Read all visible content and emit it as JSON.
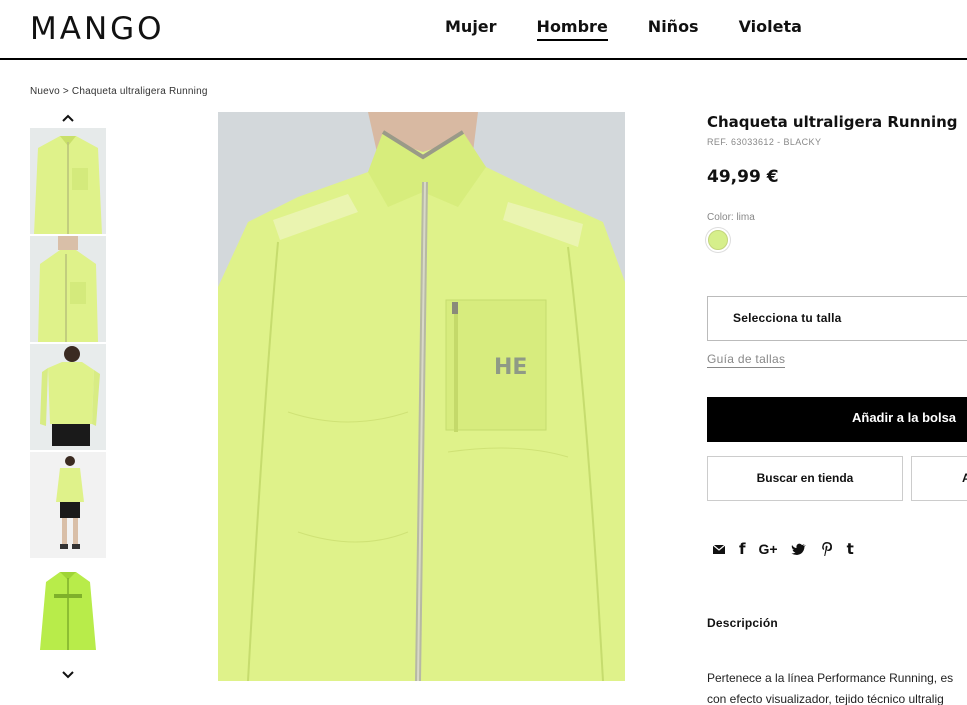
{
  "header": {
    "logo": "MANGO",
    "nav": [
      {
        "label": "Mujer",
        "active": false
      },
      {
        "label": "Hombre",
        "active": true
      },
      {
        "label": "Niños",
        "active": false
      },
      {
        "label": "Violeta",
        "active": false
      }
    ]
  },
  "breadcrumb": "Nuevo > Chaqueta ultraligera Running",
  "product": {
    "title": "Chaqueta ultraligera Running",
    "ref": "REF. 63033612 - BLACKY",
    "price": "49,99 €",
    "color_label": "Color: lima",
    "color_swatch": "#d6ef8b",
    "size_select": "Selecciona tu talla",
    "size_guide": "Guía de tallas",
    "add_to_bag": "Añadir a la bolsa",
    "find_in_store": "Buscar en tienda",
    "secondary_button_partial": "A",
    "description_title": "Descripción",
    "description_lines": [
      "Pertenece a la línea Performance Running, es",
      "con efecto visualizador, tejido técnico ultralig"
    ]
  },
  "share_icons": [
    "mail-icon",
    "facebook-icon",
    "google-plus-icon",
    "twitter-icon",
    "pinterest-icon",
    "tumblr-icon"
  ],
  "share_glyphs": {
    "facebook": "f",
    "google": "G+",
    "tumblr": "t"
  },
  "colors": {
    "jacket": "#dff28a",
    "jacket_shade": "#c9e06a",
    "accent_black": "#000000"
  }
}
